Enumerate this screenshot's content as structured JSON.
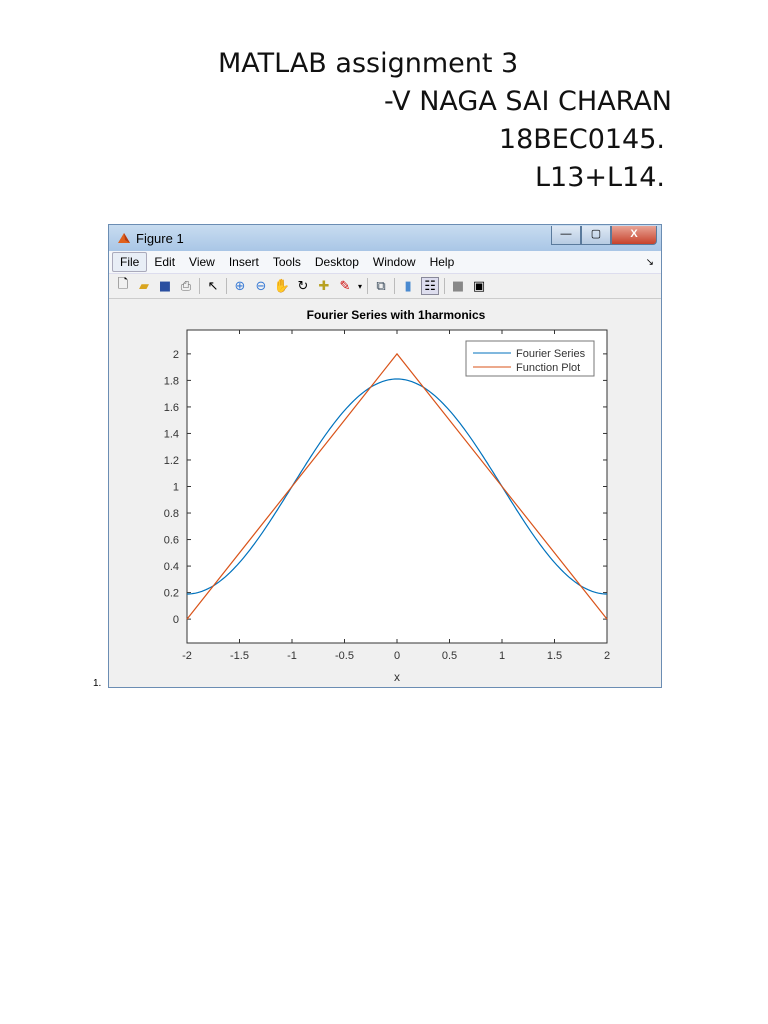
{
  "document": {
    "title_line": "MATLAB assignment 3",
    "author_line": "-V NAGA SAI CHARAN",
    "reg_line": "18BEC0145.",
    "slot_line": "L13+L14.",
    "list_number": "1."
  },
  "window": {
    "title": "Figure 1",
    "controls": {
      "minimize": "—",
      "maximize": "▢",
      "close": "X"
    },
    "menu": [
      "File",
      "Edit",
      "View",
      "Insert",
      "Tools",
      "Desktop",
      "Window",
      "Help"
    ],
    "toolbar_icons": [
      "new-file-icon",
      "open-folder-icon",
      "save-icon",
      "print-icon",
      "pointer-icon",
      "zoom-in-icon",
      "zoom-out-icon",
      "pan-hand-icon",
      "rotate-3d-icon",
      "data-cursor-icon",
      "brush-icon",
      "link-icon",
      "colorbar-icon",
      "legend-icon",
      "hide-plot-tools-icon",
      "show-plot-tools-icon"
    ]
  },
  "chart_data": {
    "type": "line",
    "title": "Fourier Series with 1harmonics",
    "xlabel": "x",
    "ylabel": "",
    "xlim": [
      -2,
      2
    ],
    "ylim": [
      -0.18,
      2.18
    ],
    "xticks": [
      "-2",
      "-1.5",
      "-1",
      "-0.5",
      "0",
      "0.5",
      "1",
      "1.5",
      "2"
    ],
    "yticks": [
      "0",
      "0.2",
      "0.4",
      "0.6",
      "0.8",
      "1",
      "1.2",
      "1.4",
      "1.6",
      "1.8",
      "2"
    ],
    "legend": {
      "placement": "top-right",
      "entries": [
        "Fourier Series",
        "Function Plot"
      ]
    },
    "series": [
      {
        "name": "Fourier Series",
        "color": "#0072bd",
        "formula": "1 + (8/pi^2)cos(pi x/2)",
        "x": [
          -2,
          -1.5,
          -1,
          -0.5,
          0,
          0.5,
          1,
          1.5,
          2
        ],
        "y": [
          0.19,
          0.43,
          1.0,
          1.57,
          1.81,
          1.57,
          1.0,
          0.43,
          0.19
        ]
      },
      {
        "name": "Function Plot",
        "color": "#d95319",
        "x": [
          -2,
          0,
          2
        ],
        "y": [
          0,
          2,
          0
        ]
      }
    ]
  }
}
